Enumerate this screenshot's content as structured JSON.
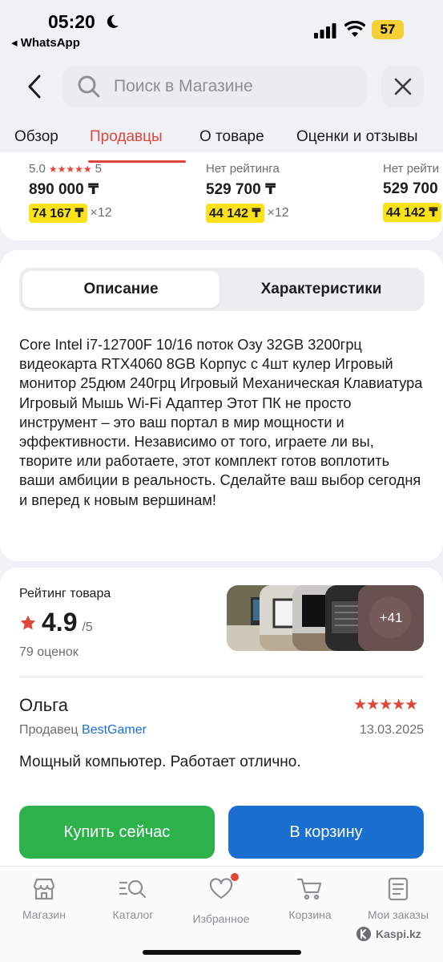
{
  "status": {
    "time": "05:20",
    "back_app": "◂ WhatsApp",
    "battery": "57"
  },
  "search": {
    "placeholder": "Поиск в Магазине"
  },
  "tabs": [
    {
      "label": "Обзор"
    },
    {
      "label": "Продавцы"
    },
    {
      "label": "О товаре"
    },
    {
      "label": "Оценки и отзывы"
    }
  ],
  "sellers": [
    {
      "rating_text": "5.0",
      "stars": "★★★★★",
      "rating_count": "5",
      "price": "890 000 ₸",
      "installment": "74 167 ₸",
      "multiplier": "×12"
    },
    {
      "rating_text": "Нет рейтинга",
      "stars": "",
      "rating_count": "",
      "price": "529 700 ₸",
      "installment": "44 142 ₸",
      "multiplier": "×12"
    },
    {
      "rating_text": "Нет рейти",
      "stars": "",
      "rating_count": "",
      "price": "529 700",
      "installment": "44 142 ₸",
      "multiplier": ""
    }
  ],
  "description": {
    "tab_description": "Описание",
    "tab_specs": "Характеристики",
    "text": "Core Intel i7-12700F 10/16 поток Озу 32GB 3200грц видеокарта RTX4060 8GB Корпус с 4шт кулер Игровый монитор 25дюм 240грц Игровый Механическая Клавиатура Игровый Мышь Wi-Fi Адаптер Этот ПК не просто инструмент – это ваш портал в мир мощности и эффективности. Независимо от того, играете ли вы, творите или работаете, этот комплект готов воплотить ваши амбиции в реальность. Сделайте ваш выбор сегодня и вперед к новым вершинам!"
  },
  "reviews": {
    "label": "Рейтинг товара",
    "score": "4.9",
    "score_of": "/5",
    "count": "79 оценок",
    "more_photos": "+41",
    "review": {
      "author": "Ольга",
      "stars": "★★★★★",
      "seller_prefix": "Продавец",
      "seller_name": "BestGamer",
      "date": "13.03.2025",
      "text": "Мощный компьютер. Работает отлично."
    }
  },
  "actions": {
    "buy_now": "Купить сейчас",
    "add_to_cart": "В корзину"
  },
  "nav": [
    {
      "label": "Магазин",
      "icon": "shop-icon"
    },
    {
      "label": "Каталог",
      "icon": "catalog-search-icon"
    },
    {
      "label": "Избранное",
      "icon": "heart-icon"
    },
    {
      "label": "Корзина",
      "icon": "cart-icon"
    },
    {
      "label": "Мои заказы",
      "icon": "orders-icon"
    }
  ],
  "watermark": "Kaspi.kz",
  "colors": {
    "accent_red": "#e0453a",
    "buy_green": "#2db14a",
    "cart_blue": "#1a6fd1",
    "installment_yellow": "#fbe11a"
  }
}
